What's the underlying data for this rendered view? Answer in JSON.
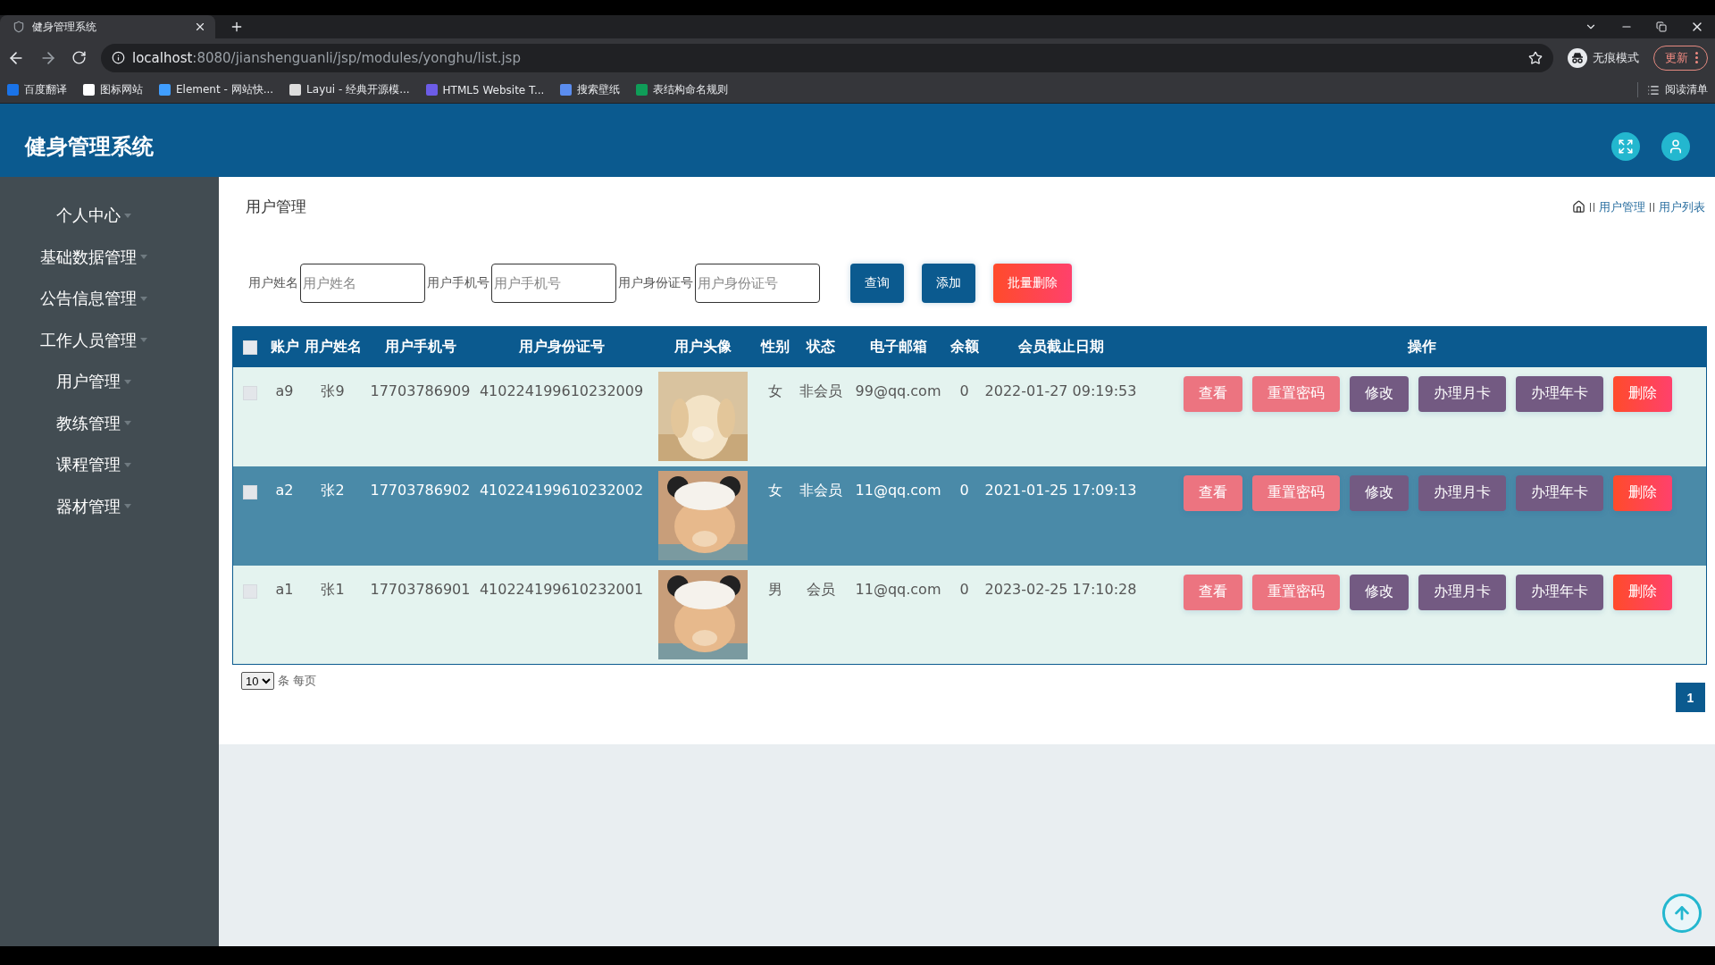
{
  "browser": {
    "tab_title": "健身管理系统",
    "url_host": "localhost",
    "url_path": ":8080/jianshenguanli/jsp/modules/yonghu/list.jsp",
    "incognito_label": "无痕模式",
    "update_button": "更新",
    "bookmarks": [
      {
        "label": "百度翻译",
        "color": "#1a73e8"
      },
      {
        "label": "图标网站",
        "color": "#ffffff"
      },
      {
        "label": "Element - 网站快...",
        "color": "#409eff"
      },
      {
        "label": "Layui - 经典开源模...",
        "color": "#dddddd"
      },
      {
        "label": "HTML5 Website T...",
        "color": "#6c5ce7"
      },
      {
        "label": "搜索壁纸",
        "color": "#5b8def"
      },
      {
        "label": "表结构命名规则",
        "color": "#0f9d58"
      }
    ],
    "reading_list": "阅读清单"
  },
  "app": {
    "title": "健身管理系统"
  },
  "sidebar": {
    "items": [
      {
        "label": "个人中心"
      },
      {
        "label": "基础数据管理"
      },
      {
        "label": "公告信息管理"
      },
      {
        "label": "工作人员管理"
      },
      {
        "label": "用户管理"
      },
      {
        "label": "教练管理"
      },
      {
        "label": "课程管理"
      },
      {
        "label": "器材管理"
      }
    ]
  },
  "page_title": "用户管理",
  "breadcrumb": [
    "用户管理",
    "用户列表"
  ],
  "search": {
    "fields": [
      {
        "label": "用户姓名",
        "placeholder": "用户姓名"
      },
      {
        "label": "用户手机号",
        "placeholder": "用户手机号"
      },
      {
        "label": "用户身份证号",
        "placeholder": "用户身份证号"
      }
    ],
    "buttons": [
      {
        "label": "查询",
        "kind": "primary"
      },
      {
        "label": "添加",
        "kind": "primary"
      },
      {
        "label": "批量删除",
        "kind": "danger"
      }
    ]
  },
  "table": {
    "select_all_checked": false,
    "columns": [
      "账户",
      "用户姓名",
      "用户手机号",
      "用户身份证号",
      "用户头像",
      "性别",
      "状态",
      "电子邮箱",
      "余额",
      "会员截止日期",
      "操作"
    ],
    "rows": [
      {
        "checked": false,
        "highlighted": false,
        "account": "a9",
        "name": "张9",
        "phone": "17703786909",
        "id_number": "410224199610232009",
        "gender": "女",
        "status": "非会员",
        "email": "99@qq.com",
        "balance": "0",
        "expiry": "2022-01-27 09:19:53",
        "actions": [
          {
            "label": "查看",
            "kind": "view"
          },
          {
            "label": "重置密码",
            "kind": "reset"
          },
          {
            "label": "修改",
            "kind": "edit"
          },
          {
            "label": "办理月卡",
            "kind": "card"
          },
          {
            "label": "办理年卡",
            "kind": "card"
          },
          {
            "label": "删除",
            "kind": "delete"
          }
        ]
      },
      {
        "checked": false,
        "highlighted": true,
        "account": "a2",
        "name": "张2",
        "phone": "17703786902",
        "id_number": "410224199610232002",
        "gender": "女",
        "status": "非会员",
        "email": "11@qq.com",
        "balance": "0",
        "expiry": "2021-01-25 17:09:13",
        "actions": [
          {
            "label": "查看",
            "kind": "view"
          },
          {
            "label": "重置密码",
            "kind": "reset"
          },
          {
            "label": "修改",
            "kind": "edit"
          },
          {
            "label": "办理月卡",
            "kind": "card"
          },
          {
            "label": "办理年卡",
            "kind": "card"
          },
          {
            "label": "删除",
            "kind": "delete"
          }
        ]
      },
      {
        "checked": false,
        "highlighted": false,
        "account": "a1",
        "name": "张1",
        "phone": "17703786901",
        "id_number": "410224199610232001",
        "gender": "男",
        "status": "会员",
        "email": "11@qq.com",
        "balance": "0",
        "expiry": "2023-02-25 17:10:28",
        "actions": [
          {
            "label": "查看",
            "kind": "view"
          },
          {
            "label": "重置密码",
            "kind": "reset"
          },
          {
            "label": "修改",
            "kind": "edit"
          },
          {
            "label": "办理月卡",
            "kind": "card"
          },
          {
            "label": "办理年卡",
            "kind": "card"
          },
          {
            "label": "删除",
            "kind": "delete"
          }
        ]
      }
    ]
  },
  "pagination": {
    "page_size": "10",
    "page_size_suffix": "条 每页",
    "pages": [
      {
        "label": "1",
        "selected": true
      }
    ]
  }
}
